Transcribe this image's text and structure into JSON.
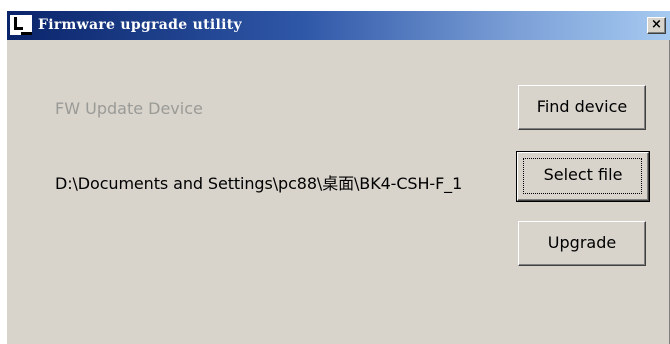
{
  "window": {
    "title": "Firmware upgrade utility",
    "app_icon": "app-window-icon",
    "close_label": "×",
    "close_icon": "close-icon"
  },
  "main": {
    "device_label": "FW Update Device",
    "file_path": "D:\\Documents and Settings\\pc88\\桌面\\BK4-CSH-F_1"
  },
  "buttons": {
    "find_device": "Find device",
    "select_file": "Select file",
    "upgrade": "Upgrade"
  },
  "colors": {
    "titlebar_start": "#0a246a",
    "titlebar_end": "#a6caf0",
    "window_bg": "#d8d4cc",
    "disabled_text": "#9a9a96"
  }
}
